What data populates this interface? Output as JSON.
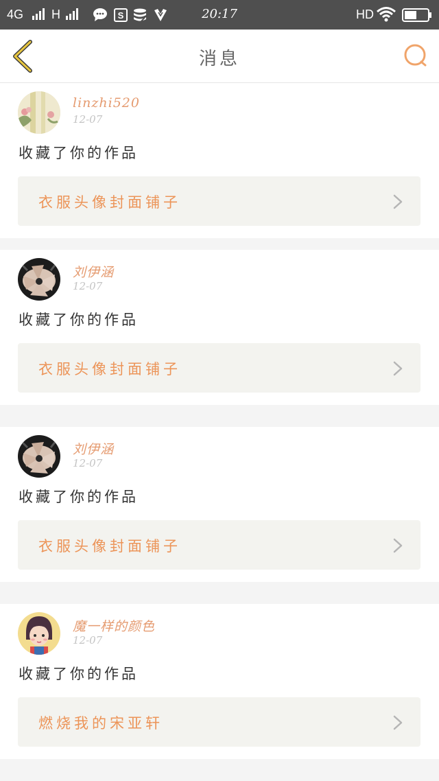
{
  "status_bar": {
    "network_1": "4G",
    "network_2": "H",
    "time": "20:17",
    "hd": "HD",
    "icons": [
      "signal-icon",
      "signal-icon",
      "message-icon",
      "s-icon",
      "database-icon",
      "v-icon",
      "wifi-icon",
      "battery-icon"
    ]
  },
  "header": {
    "title": "消息",
    "back_icon": "chevron-left-icon",
    "search_icon": "search-icon",
    "accent_back": "#e8b82a",
    "accent_search": "#f0a46a"
  },
  "messages": [
    {
      "username": "linzhi520",
      "time": "12-07",
      "action": "收藏了你的作品",
      "work_title": "衣服头像封面铺子",
      "avatar": "flowers-avatar"
    },
    {
      "username": "刘伊涵",
      "time": "12-07",
      "action": "收藏了你的作品",
      "work_title": "衣服头像封面铺子",
      "avatar": "hands-avatar"
    },
    {
      "username": "刘伊涵",
      "time": "12-07",
      "action": "收藏了你的作品",
      "work_title": "衣服头像封面铺子",
      "avatar": "hands-avatar"
    },
    {
      "username": "魔一样的颜色",
      "time": "12-07",
      "action": "收藏了你的作品",
      "work_title": "燃烧我的宋亚轩",
      "avatar": "cartoon-girl-avatar"
    }
  ],
  "colors": {
    "username": "#e59b70",
    "work_title": "#ec9458",
    "work_box_bg": "#f3f3ef",
    "page_bg": "#f4f4f4"
  }
}
